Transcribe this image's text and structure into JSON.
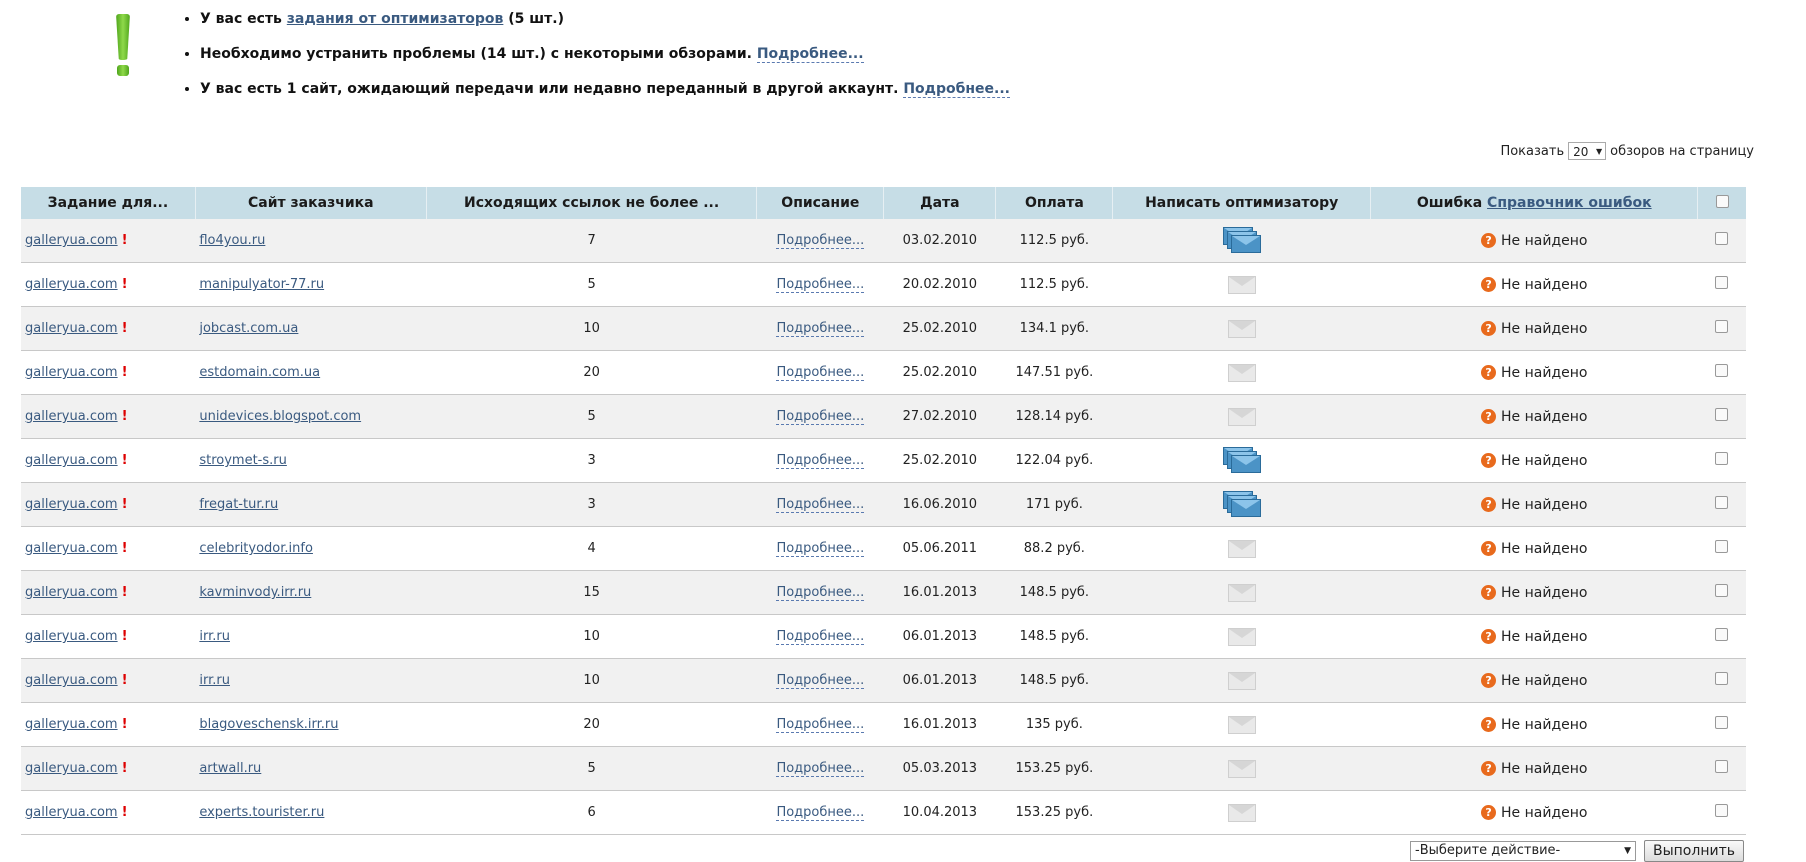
{
  "notice": {
    "line1_prefix": "У вас есть ",
    "line1_link": "задания от оптимизаторов",
    "line1_suffix": " (5 шт.)",
    "line2_text": "Необходимо устранить проблемы (14 шт.) с некоторыми обзорами. ",
    "line2_link": "Подробнее...",
    "line3_text": "У вас есть 1 сайт, ожидающий передачи или недавно переданный в другой аккаунт. ",
    "line3_link": "Подробнее..."
  },
  "perpage": {
    "prefix": "Показать",
    "value": "20",
    "suffix": "обзоров на страницу"
  },
  "table": {
    "headers": {
      "task": "Задание для...",
      "site": "Сайт заказчика",
      "links": "Исходящих ссылок не более ...",
      "desc": "Описание",
      "date": "Дата",
      "pay": "Оплата",
      "write": "Написать оптимизатору",
      "error": "Ошибка",
      "error_link": "Справочник ошибок"
    },
    "rows": [
      {
        "task": "galleryua.com",
        "site": "flo4you.ru",
        "links": "7",
        "desc": "Подробнее...",
        "date": "03.02.2010",
        "pay": "112.5 руб.",
        "mail": "multi",
        "error": "Не найдено"
      },
      {
        "task": "galleryua.com",
        "site": "manipulyator-77.ru",
        "links": "5",
        "desc": "Подробнее...",
        "date": "20.02.2010",
        "pay": "112.5 руб.",
        "mail": "single",
        "error": "Не найдено"
      },
      {
        "task": "galleryua.com",
        "site": "jobcast.com.ua",
        "links": "10",
        "desc": "Подробнее...",
        "date": "25.02.2010",
        "pay": "134.1 руб.",
        "mail": "single",
        "error": "Не найдено"
      },
      {
        "task": "galleryua.com",
        "site": "estdomain.com.ua",
        "links": "20",
        "desc": "Подробнее...",
        "date": "25.02.2010",
        "pay": "147.51 руб.",
        "mail": "single",
        "error": "Не найдено"
      },
      {
        "task": "galleryua.com",
        "site": "unidevices.blogspot.com",
        "links": "5",
        "desc": "Подробнее...",
        "date": "27.02.2010",
        "pay": "128.14 руб.",
        "mail": "single",
        "error": "Не найдено"
      },
      {
        "task": "galleryua.com",
        "site": "stroymet-s.ru",
        "links": "3",
        "desc": "Подробнее...",
        "date": "25.02.2010",
        "pay": "122.04 руб.",
        "mail": "multi",
        "error": "Не найдено"
      },
      {
        "task": "galleryua.com",
        "site": "fregat-tur.ru",
        "links": "3",
        "desc": "Подробнее...",
        "date": "16.06.2010",
        "pay": "171 руб.",
        "mail": "multi",
        "error": "Не найдено"
      },
      {
        "task": "galleryua.com",
        "site": "celebrityodor.info",
        "links": "4",
        "desc": "Подробнее...",
        "date": "05.06.2011",
        "pay": "88.2 руб.",
        "mail": "single",
        "error": "Не найдено"
      },
      {
        "task": "galleryua.com",
        "site": "kavminvody.irr.ru",
        "links": "15",
        "desc": "Подробнее...",
        "date": "16.01.2013",
        "pay": "148.5 руб.",
        "mail": "single",
        "error": "Не найдено"
      },
      {
        "task": "galleryua.com",
        "site": "irr.ru",
        "links": "10",
        "desc": "Подробнее...",
        "date": "06.01.2013",
        "pay": "148.5 руб.",
        "mail": "single",
        "error": "Не найдено"
      },
      {
        "task": "galleryua.com",
        "site": "irr.ru",
        "links": "10",
        "desc": "Подробнее...",
        "date": "06.01.2013",
        "pay": "148.5 руб.",
        "mail": "single",
        "error": "Не найдено"
      },
      {
        "task": "galleryua.com",
        "site": "blagoveschensk.irr.ru",
        "links": "20",
        "desc": "Подробнее...",
        "date": "16.01.2013",
        "pay": "135 руб.",
        "mail": "single",
        "error": "Не найдено"
      },
      {
        "task": "galleryua.com",
        "site": "artwall.ru",
        "links": "5",
        "desc": "Подробнее...",
        "date": "05.03.2013",
        "pay": "153.25 руб.",
        "mail": "single",
        "error": "Не найдено"
      },
      {
        "task": "galleryua.com",
        "site": "experts.tourister.ru",
        "links": "6",
        "desc": "Подробнее...",
        "date": "10.04.2013",
        "pay": "153.25 руб.",
        "mail": "single",
        "error": "Не найдено"
      }
    ]
  },
  "actions": {
    "select_value": "-Выберите действие-",
    "submit_label": "Выполнить"
  },
  "colors": {
    "header_bg": "#c6dde6",
    "link": "#3a5a80",
    "alert": "#dd0000",
    "error_icon": "#e86a1d"
  },
  "icons": {
    "notice": "exclamation-icon",
    "mail_multi": "envelopes-stack-icon",
    "mail_single": "envelope-icon",
    "error": "question-icon"
  }
}
